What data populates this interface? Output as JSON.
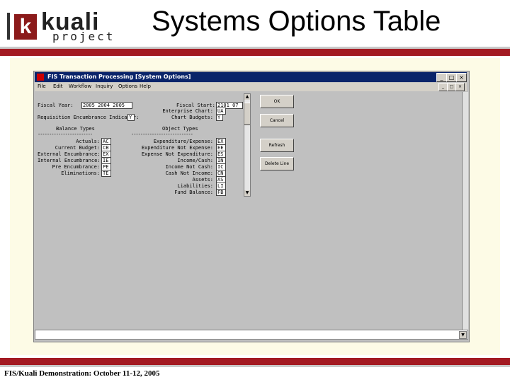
{
  "slide": {
    "logo_main": "kuali",
    "logo_sub": "project",
    "logo_k": "k",
    "title": "Systems Options Table",
    "footer": "FIS/Kuali Demonstration:  October 11-12, 2005"
  },
  "window": {
    "title": "FIS Transaction Processing  [System Options]",
    "min": "_",
    "max": "□",
    "close": "×"
  },
  "menu": [
    "File",
    "Edit",
    "Workflow",
    "Inquiry",
    "Options",
    "Help"
  ],
  "form": {
    "fiscal_year_label": "Fiscal Year:",
    "fiscal_year_value": "2005  2004 2005",
    "fiscal_start_label": "Fiscal Start:",
    "fiscal_start_value": "2101  07",
    "enterprise_chart_label": "Enterprise Chart:",
    "enterprise_chart_value": "UA",
    "req_encumbrance_label": "Requisition Encumbrance Indicator:",
    "req_encumbrance_value": "Y",
    "chart_budgets_label": "Chart Budgets:",
    "chart_budgets_value": "Y",
    "balance_types_header": "Balance Types",
    "object_types_header": "Object Types",
    "balance_types": [
      {
        "label": "Actuals:",
        "value": "AC"
      },
      {
        "label": "Current Budget:",
        "value": "CB"
      },
      {
        "label": "External Encumbrance:",
        "value": "EX"
      },
      {
        "label": "Internal Encumbrance:",
        "value": "IE"
      },
      {
        "label": "Pre Encumbrance:",
        "value": "PE"
      },
      {
        "label": "Eliminations:",
        "value": "TE"
      }
    ],
    "object_types": [
      {
        "label": "Expenditure/Expense:",
        "value": "EX"
      },
      {
        "label": "Expenditure Not Expense:",
        "value": "EE"
      },
      {
        "label": "Expense Not Expenditure:",
        "value": "ES"
      },
      {
        "label": "Income/Cash:",
        "value": "IN"
      },
      {
        "label": "Income Not Cash:",
        "value": "IC"
      },
      {
        "label": "Cash Not Income:",
        "value": "CN"
      },
      {
        "label": "Assets:",
        "value": "AS"
      },
      {
        "label": "Liabilities:",
        "value": "LI"
      },
      {
        "label": "Fund Balance:",
        "value": "FB"
      }
    ]
  },
  "buttons": {
    "ok": "OK",
    "cancel": "Cancel",
    "refresh": "Refresh",
    "delete_line": "Delete Line"
  },
  "scroll": {
    "up": "▲",
    "down": "▼"
  },
  "colors": {
    "brand_red": "#a31a22",
    "titlebar": "#0a246a",
    "window_gray": "#c0c0c0",
    "backdrop": "#fdfbe6"
  }
}
